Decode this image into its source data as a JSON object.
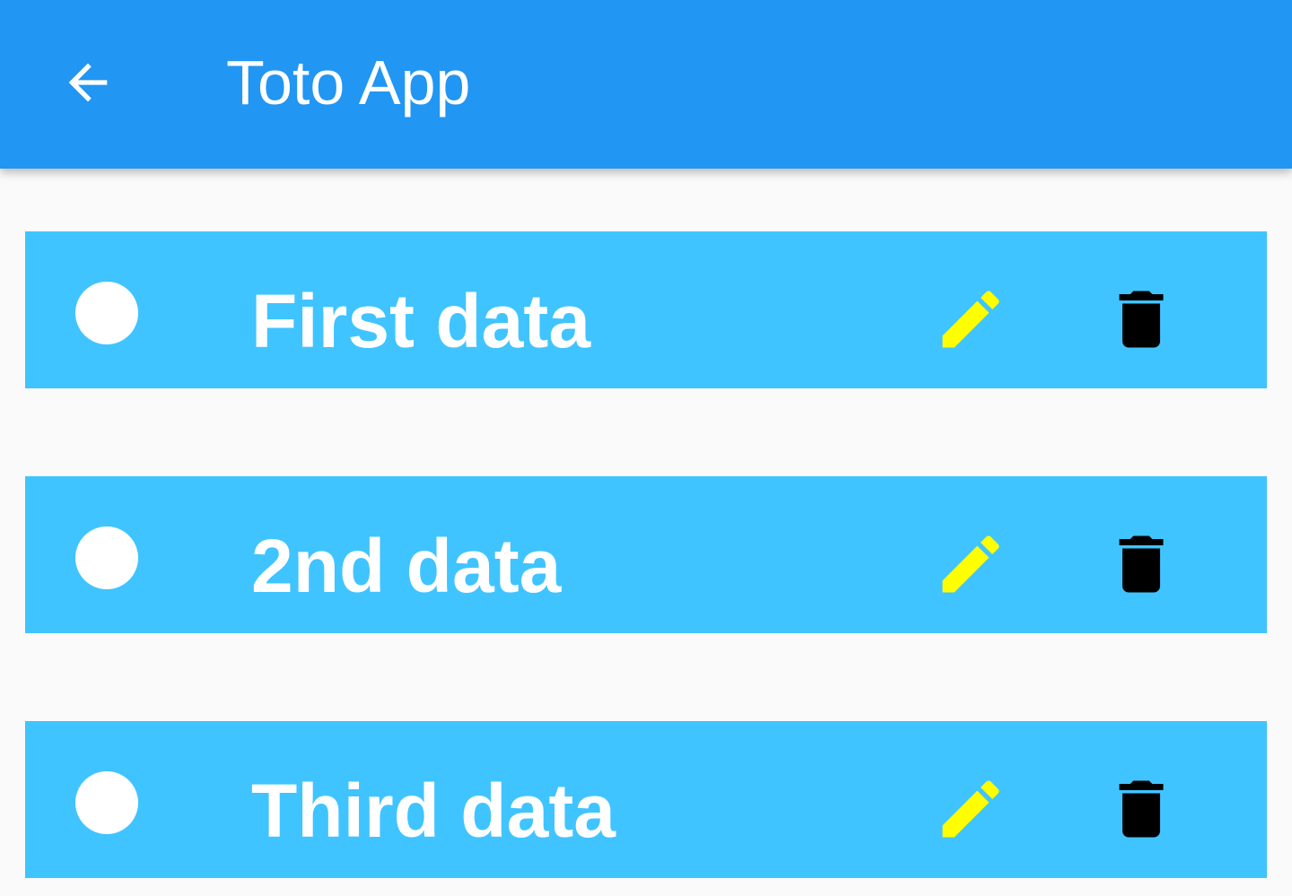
{
  "app_bar": {
    "title": "Toto App",
    "back_icon": "arrow-back-icon",
    "background_color": "#2196f3"
  },
  "todos": [
    {
      "text": "First data",
      "status_icon": "circle-icon",
      "edit_icon": "pencil-icon",
      "delete_icon": "trash-icon"
    },
    {
      "text": "2nd data",
      "status_icon": "circle-icon",
      "edit_icon": "pencil-icon",
      "delete_icon": "trash-icon"
    },
    {
      "text": "Third data",
      "status_icon": "circle-icon",
      "edit_icon": "pencil-icon",
      "delete_icon": "trash-icon"
    }
  ],
  "colors": {
    "item_background": "#40c4ff",
    "edit_icon": "#ffff00",
    "delete_icon": "#000000",
    "text": "#ffffff",
    "page_background": "#fafafa"
  }
}
